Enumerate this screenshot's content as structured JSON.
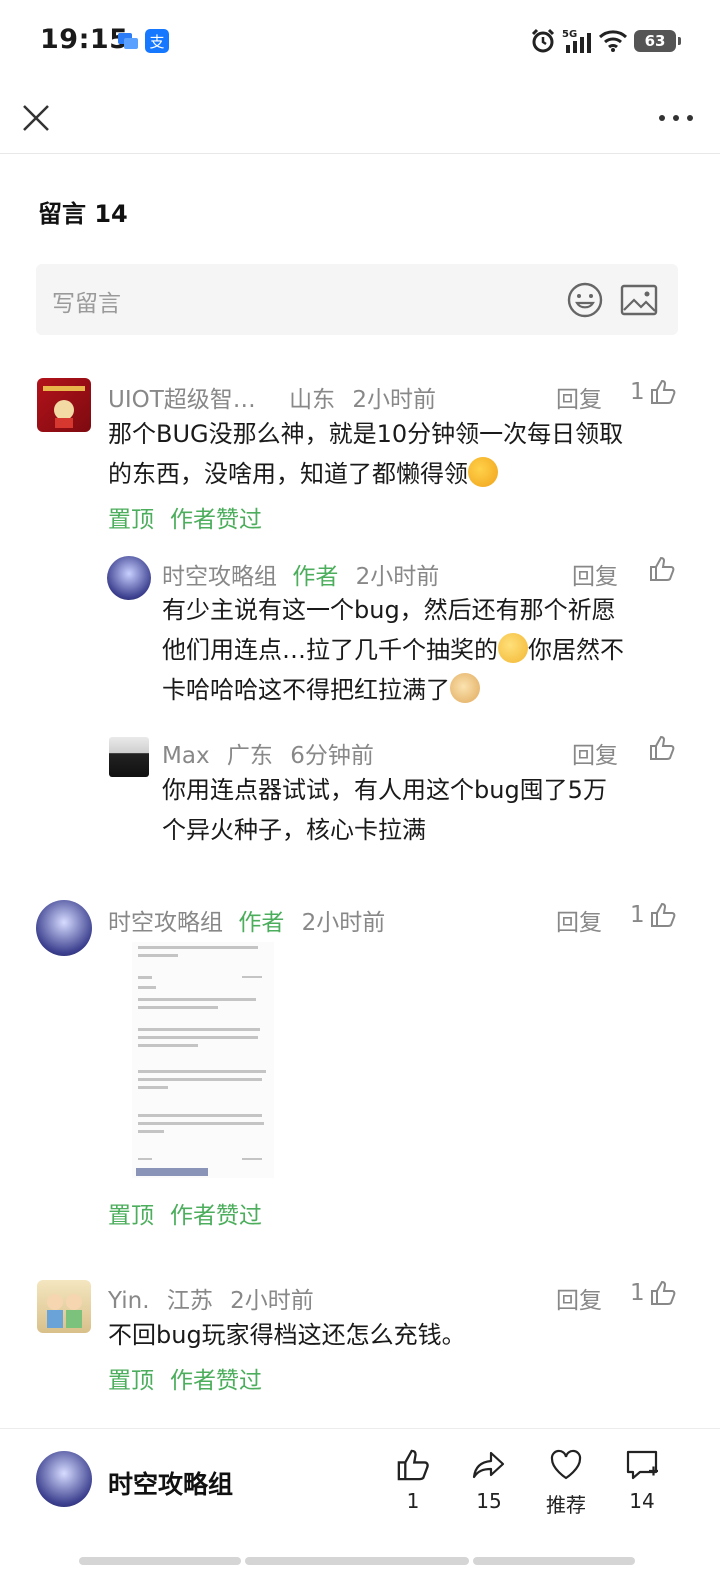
{
  "status_bar": {
    "time": "19:15",
    "battery": "63"
  },
  "header": {
    "comments_title": "留言 14"
  },
  "write_box": {
    "placeholder": "写留言"
  },
  "comments": [
    {
      "user": "UIOT超级智…",
      "location": "山东",
      "time": "2小时前",
      "reply": "回复",
      "likes": "1",
      "text_lines": [
        "那个BUG没那么神，就是10分钟领一次每日领取",
        "的东西，没啥用，知道了都懒得领"
      ],
      "tags": [
        "置顶",
        "作者赞过"
      ],
      "replies": [
        {
          "user": "时空攻略组",
          "author_tag": "作者",
          "time": "2小时前",
          "reply": "回复",
          "text_lines": [
            "有少主说有这一个bug，然后还有那个祈愿",
            "他们用连点…拉了几千个抽奖的",
            "你居然不",
            "卡哈哈哈这不得把红拉满了"
          ]
        },
        {
          "user": "Max",
          "location": "广东",
          "time": "6分钟前",
          "reply": "回复",
          "text_lines": [
            "你用连点器试试，有人用这个bug囤了5万",
            "个异火种子，核心卡拉满"
          ]
        }
      ]
    },
    {
      "user": "时空攻略组",
      "author_tag": "作者",
      "time": "2小时前",
      "reply": "回复",
      "likes": "1",
      "tags": [
        "置顶",
        "作者赞过"
      ]
    },
    {
      "user": "Yin.",
      "location": "江苏",
      "time": "2小时前",
      "reply": "回复",
      "likes": "1",
      "text_lines": [
        "不回bug玩家得档这还怎么充钱。"
      ],
      "tags": [
        "置顶",
        "作者赞过"
      ]
    }
  ],
  "bottom_bar": {
    "account": "时空攻略组",
    "likes": "1",
    "shares": "15",
    "recommend": "推荐",
    "comments": "14"
  },
  "colors": {
    "accent_green": "#4cae5c",
    "meta_gray": "#888888"
  }
}
